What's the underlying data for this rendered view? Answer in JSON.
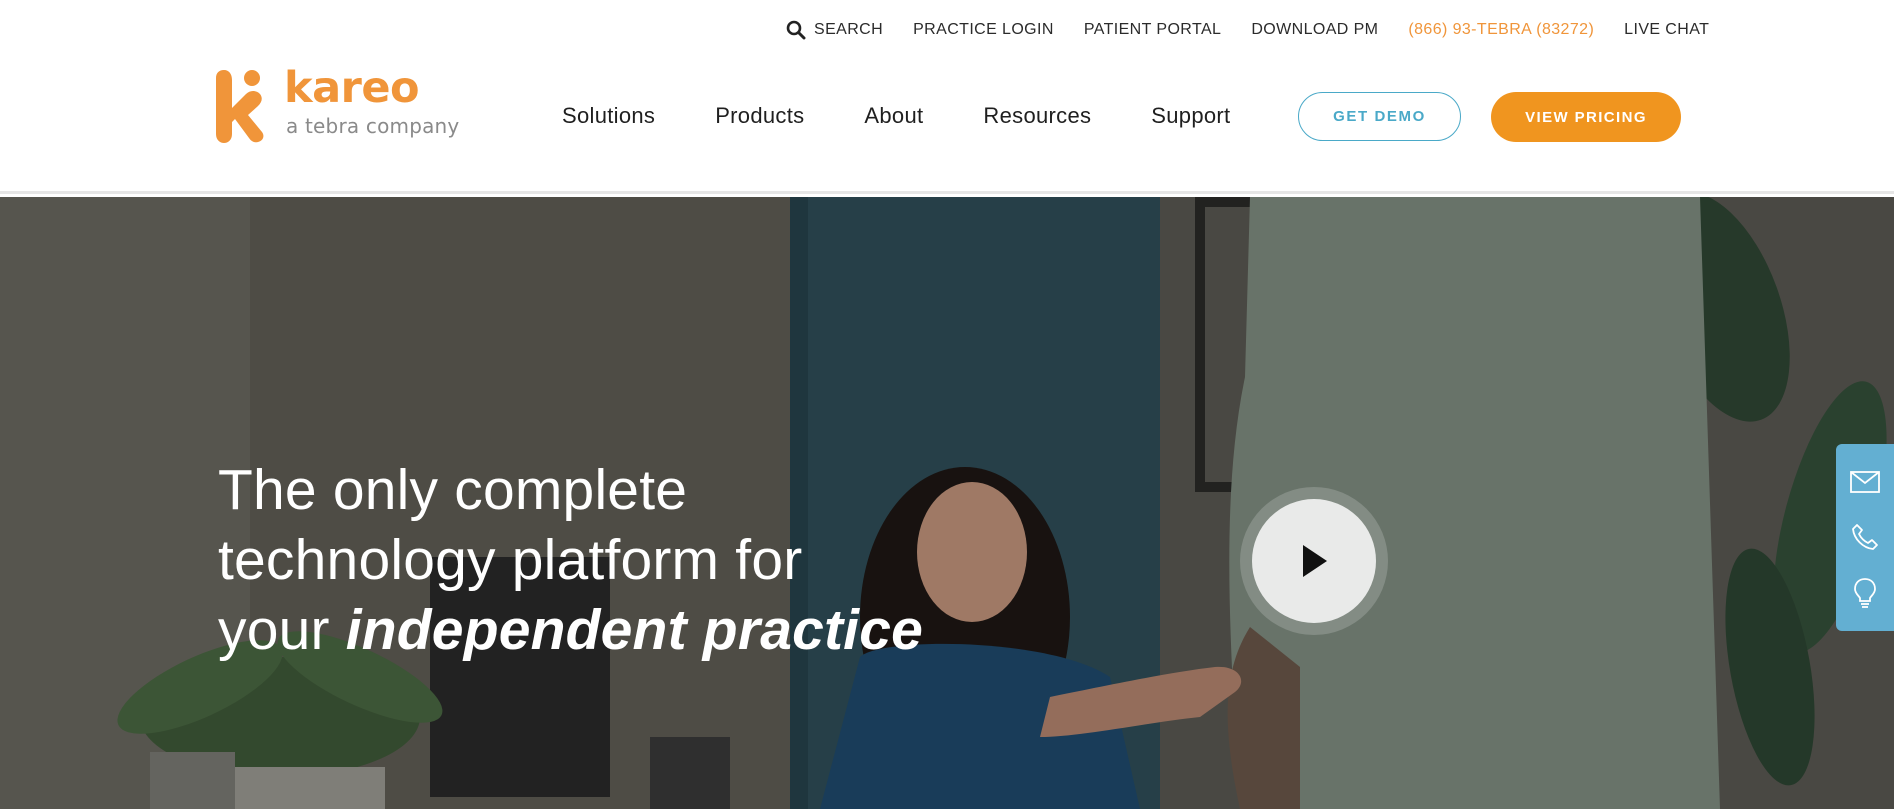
{
  "utility_nav": {
    "search": "SEARCH",
    "practice_login": "PRACTICE LOGIN",
    "patient_portal": "PATIENT PORTAL",
    "download_pm": "DOWNLOAD PM",
    "phone": "(866) 93-TEBRA (83272)",
    "live_chat": "LIVE CHAT"
  },
  "logo": {
    "wordmark": "kareo",
    "tagline": "a tebra company"
  },
  "main_nav": {
    "items": [
      "Solutions",
      "Products",
      "About",
      "Resources",
      "Support"
    ]
  },
  "buttons": {
    "get_demo": "GET DEMO",
    "view_pricing": "VIEW PRICING"
  },
  "hero": {
    "headline_line1": "The only complete",
    "headline_line2": "technology platform for",
    "headline_line3_prefix": "your ",
    "headline_line3_emphasis": "independent practice"
  },
  "icons": {
    "search": "search-icon",
    "play": "play-icon",
    "email": "email-icon",
    "phone": "phone-icon",
    "lightbulb": "lightbulb-icon"
  },
  "colors": {
    "brand_orange": "#f0951f",
    "accent_blue": "#4aa9c8",
    "sidebar_blue": "#63afd2",
    "phone_text": "#f0953a"
  }
}
